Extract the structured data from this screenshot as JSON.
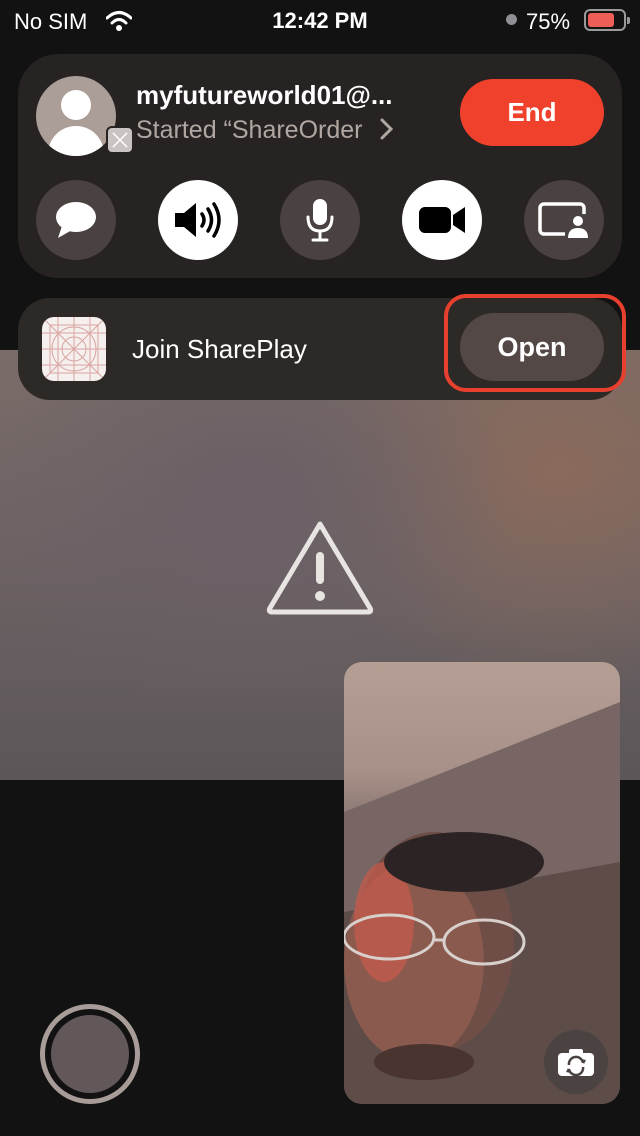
{
  "status_bar": {
    "carrier": "No SIM",
    "time": "12:42 PM",
    "battery_percent": "75%",
    "battery_level": 0.75,
    "battery_color": "#ec5f57"
  },
  "call": {
    "caller_name": "myfutureworld01@...",
    "caller_subtitle": "Started “ShareOrder",
    "end_label": "End",
    "end_color": "#f0412d",
    "controls": [
      {
        "name": "messages",
        "icon": "message-bubble-icon",
        "active": false
      },
      {
        "name": "speaker",
        "icon": "speaker-icon",
        "active": true
      },
      {
        "name": "mute",
        "icon": "microphone-icon",
        "active": false
      },
      {
        "name": "camera",
        "icon": "video-camera-icon",
        "active": true
      },
      {
        "name": "shareplay",
        "icon": "screen-share-icon",
        "active": false
      }
    ]
  },
  "shareplay": {
    "label": "Join SharePlay",
    "open_label": "Open",
    "highlight_color": "#e8402f"
  },
  "icons": {
    "warning": "warning-triangle-icon",
    "flip": "camera-flip-icon"
  }
}
